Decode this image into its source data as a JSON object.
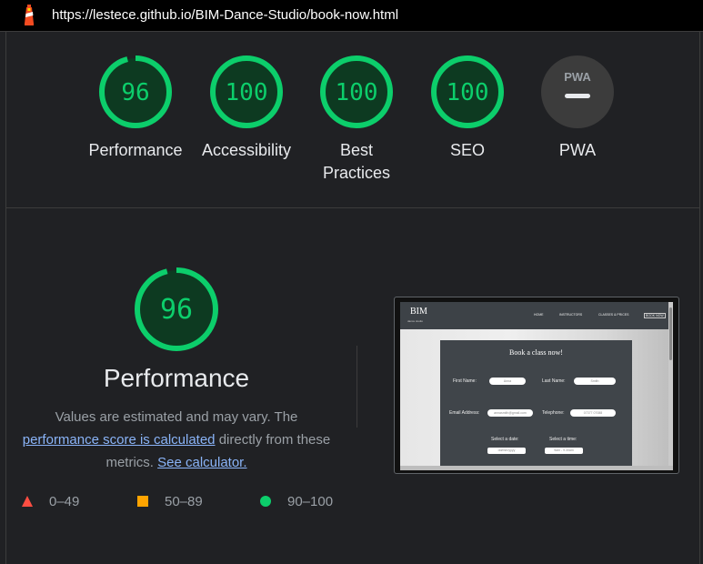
{
  "url": "https://lestece.github.io/BIM-Dance-Studio/book-now.html",
  "colors": {
    "pass": "#0cce6b",
    "average": "#ffa400",
    "fail": "#ff4e42",
    "pwa_gray": "#5f6368",
    "link": "#8ab4f8"
  },
  "gauges": [
    {
      "score": "96",
      "label": "Performance",
      "value": 96
    },
    {
      "score": "100",
      "label": "Accessibility",
      "value": 100
    },
    {
      "score": "100",
      "label_line1": "Best",
      "label_line2": "Practices",
      "value": 100
    },
    {
      "score": "100",
      "label": "SEO",
      "value": 100
    },
    {
      "badge": "PWA",
      "label": "PWA"
    }
  ],
  "performance": {
    "score": "96",
    "value": 96,
    "title": "Performance",
    "desc_1": "Values are estimated and may vary. The",
    "desc_link": "performance score is calculated",
    "desc_2": "directly from these metrics.",
    "desc_link2": "See calculator."
  },
  "legend": [
    {
      "range": "0–49",
      "icon": "triangle-icon"
    },
    {
      "range": "50–89",
      "icon": "square-icon"
    },
    {
      "range": "90–100",
      "icon": "circle-icon"
    }
  ],
  "thumbnail": {
    "brand": "BIM",
    "brand_sub": "dance studio",
    "nav": [
      "HOME",
      "INSTRUCTORS",
      "CLASSES & PRICES",
      "BOOK NOW"
    ],
    "form_title": "Book a class now!",
    "first_name_label": "First Name:",
    "first_name_value": "Anna",
    "last_name_label": "Last Name:",
    "last_name_value": "Smith",
    "email_label": "Email Address:",
    "email_value": "annasmith@gmail.com",
    "phone_label": "Telephone:",
    "phone_value": "07377 07088",
    "date_label": "Select a date:",
    "date_value": "dd/mm/yyyy",
    "time_label": "Select a time:",
    "time_value": "9am - 9.30am"
  }
}
